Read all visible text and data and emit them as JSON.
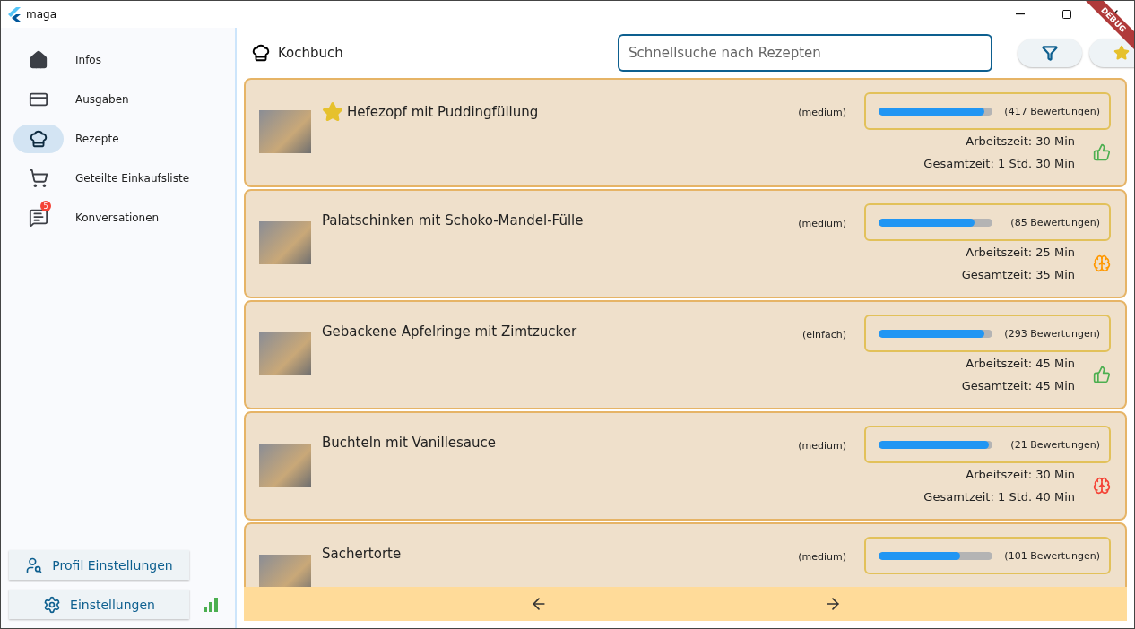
{
  "window": {
    "title": "maga"
  },
  "sidebar": {
    "items": [
      {
        "kind": "home",
        "label": "Infos",
        "selected": false
      },
      {
        "kind": "card",
        "label": "Ausgaben",
        "selected": false
      },
      {
        "kind": "recipes",
        "label": "Rezepte",
        "selected": true
      },
      {
        "kind": "cart",
        "label": "Geteilte Einkaufsliste",
        "selected": false
      },
      {
        "kind": "chat",
        "label": "Konversationen",
        "selected": false,
        "badge": "5"
      }
    ],
    "buttons": [
      {
        "kind": "profile",
        "label": "Profil Einstellungen"
      },
      {
        "kind": "settings",
        "label": "Einstellungen"
      }
    ]
  },
  "header": {
    "title": "Kochbuch",
    "search": {
      "placeholder": "Schnellsuche nach Rezepten"
    }
  },
  "debug_banner": "DEBUG",
  "recipes": [
    {
      "title": "Hefezopf mit Puddingfüllung",
      "favorite": true,
      "difficulty": "(medium)",
      "level": 0.93,
      "ratings": "(417 Bewertungen)",
      "times": [
        "Arbeitszeit: 30 Min",
        "Gesamtzeit: 1 Std. 30 Min"
      ],
      "kind": "thumb",
      "color": "#4caf50"
    },
    {
      "title": "Palatschinken mit Schoko-Mandel-Fülle",
      "favorite": false,
      "difficulty": "(medium)",
      "level": 0.84,
      "ratings": "(85 Bewertungen)",
      "times": [
        "Arbeitszeit: 25 Min",
        "Gesamtzeit: 35 Min"
      ],
      "kind": "head",
      "color": "#ff9800"
    },
    {
      "title": "Gebackene Apfelringe mit Zimtzucker",
      "favorite": false,
      "difficulty": "(einfach)",
      "level": 0.93,
      "ratings": "(293 Bewertungen)",
      "times": [
        "Arbeitszeit: 45 Min",
        "Gesamtzeit: 45 Min"
      ],
      "kind": "thumb",
      "color": "#4caf50"
    },
    {
      "title": "Buchteln mit Vanillesauce",
      "favorite": false,
      "difficulty": "(medium)",
      "level": 0.97,
      "ratings": "(21 Bewertungen)",
      "times": [
        "Arbeitszeit: 30 Min",
        "Gesamtzeit: 1 Std. 40 Min"
      ],
      "kind": "head",
      "color": "#f44336"
    },
    {
      "title": "Sachertorte",
      "favorite": false,
      "difficulty": "(medium)",
      "level": 0.72,
      "ratings": "(101 Bewertungen)"
    }
  ]
}
